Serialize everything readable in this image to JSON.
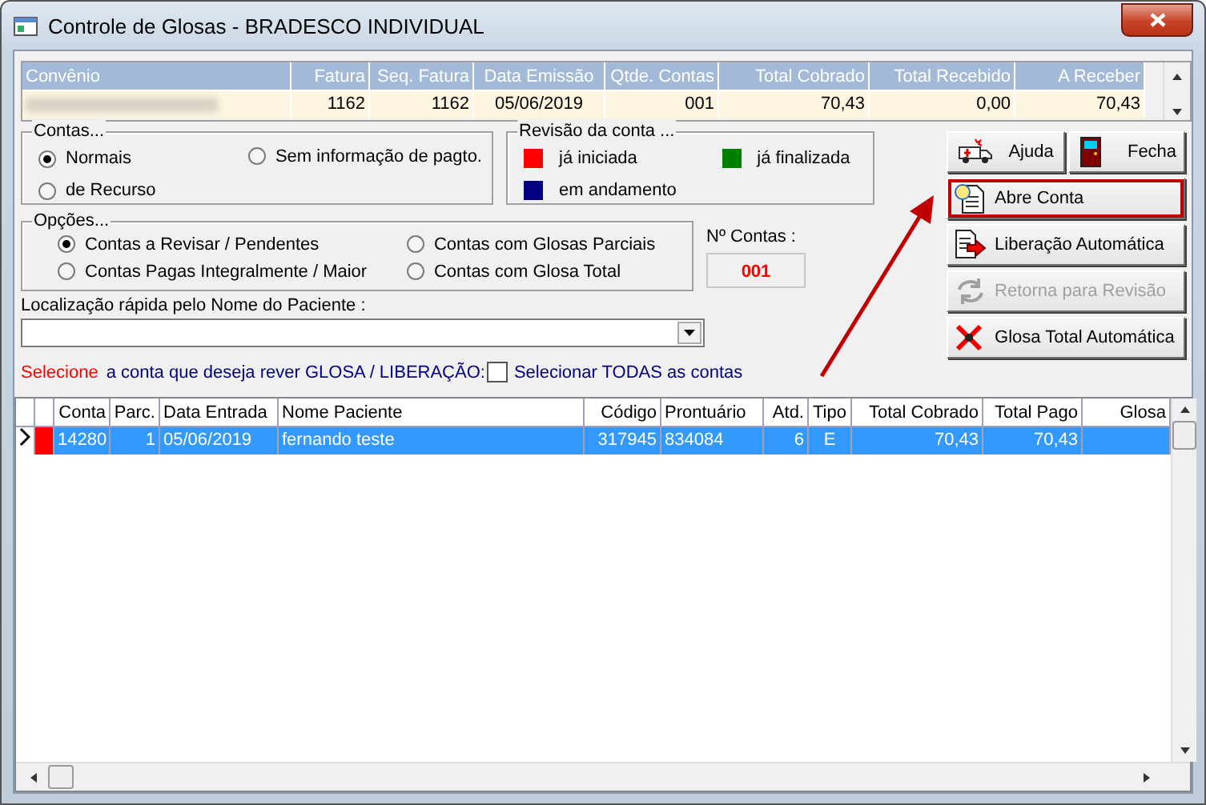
{
  "window": {
    "title": "Controle de Glosas - BRADESCO INDIVIDUAL"
  },
  "summary_table": {
    "columns": [
      "Convênio",
      "Fatura",
      "Seq. Fatura",
      "Data Emissão",
      "Qtde. Contas",
      "Total Cobrado",
      "Total Recebido",
      "A Receber"
    ],
    "rows": [
      {
        "cells": [
          "",
          "1162",
          "1162",
          "05/06/2019",
          "001",
          "70,43",
          "0,00",
          "70,43"
        ]
      }
    ]
  },
  "contas": {
    "title": "Contas...",
    "options": [
      {
        "label": "Normais",
        "selected": true
      },
      {
        "label": "de Recurso",
        "selected": false
      },
      {
        "label": "Sem informação de pagto.",
        "selected": false
      }
    ]
  },
  "revisao": {
    "title": "Revisão da conta ...",
    "legend": [
      {
        "label": "já iniciada",
        "color": "#ff0000"
      },
      {
        "label": "em andamento",
        "color": "#000080"
      },
      {
        "label": "já finalizada",
        "color": "#008000"
      }
    ]
  },
  "opcoes": {
    "title": "Opções...",
    "options": [
      {
        "label": "Contas a Revisar / Pendentes",
        "selected": true
      },
      {
        "label": "Contas Pagas Integralmente / Maior",
        "selected": false
      },
      {
        "label": "Contas com Glosas Parciais",
        "selected": false
      },
      {
        "label": "Contas com Glosa Total",
        "selected": false
      }
    ]
  },
  "n_contas": {
    "label": "Nº Contas :",
    "value": "001"
  },
  "search": {
    "label": "Localização rápida pelo Nome do Paciente :"
  },
  "instruction": {
    "highlight": "Selecione",
    "text": "a conta que deseja rever GLOSA / LIBERAÇÃO:"
  },
  "select_all": {
    "label": "Selecionar TODAS as contas",
    "checked": false
  },
  "buttons": [
    {
      "label": "Ajuda",
      "disabled": false,
      "highlighted": false
    },
    {
      "label": "Fecha",
      "disabled": false,
      "highlighted": false
    },
    {
      "label": "Abre Conta",
      "disabled": false,
      "highlighted": true
    },
    {
      "label": "Liberação Automática",
      "disabled": false,
      "highlighted": false
    },
    {
      "label": "Retorna para Revisão",
      "disabled": true,
      "highlighted": false
    },
    {
      "label": "Glosa Total Automática",
      "disabled": false,
      "highlighted": false
    }
  ],
  "accounts_table": {
    "columns": [
      "Conta",
      "Parc.",
      "Data Entrada",
      "Nome Paciente",
      "Código",
      "Prontuário",
      "Atd.",
      "Tipo",
      "Total Cobrado",
      "Total Pago",
      "Glosa"
    ],
    "rows": [
      {
        "selected": true,
        "current": true,
        "color": "#ff0000",
        "cells": [
          "14280",
          "1",
          "05/06/2019",
          "fernando teste",
          "317945",
          "834084",
          "6",
          "E",
          "70,43",
          "70,43",
          ""
        ]
      }
    ]
  }
}
